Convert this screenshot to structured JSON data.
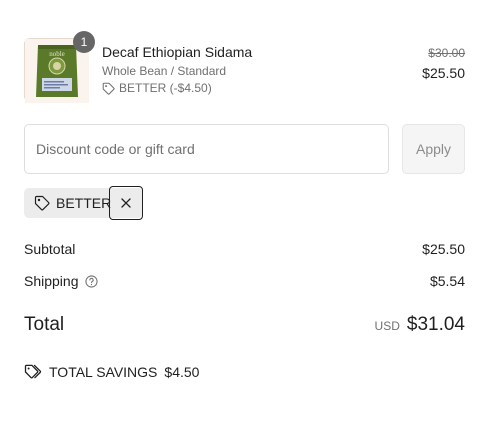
{
  "colors": {
    "text": "#1f1f1f",
    "muted": "#707070",
    "chip_bg": "#ececec",
    "badge_bg": "#666666"
  },
  "product": {
    "name": "Decaf Ethiopian Sidama",
    "variant": "Whole Bean / Standard",
    "discount_label": "BETTER (-$4.50)",
    "original_price": "$30.00",
    "price": "$25.50",
    "quantity": "1",
    "brand_text": "noble"
  },
  "discount_form": {
    "placeholder": "Discount code or gift card",
    "apply_label": "Apply"
  },
  "applied_code": {
    "label": "BETTER"
  },
  "summary": {
    "subtotal_label": "Subtotal",
    "subtotal_value": "$25.50",
    "shipping_label": "Shipping",
    "shipping_value": "$5.54",
    "total_label": "Total",
    "currency": "USD",
    "total_value": "$31.04",
    "savings_label": "TOTAL SAVINGS",
    "savings_value": "$4.50"
  },
  "icons": [
    "tag-icon",
    "close-icon",
    "help-circle-icon",
    "tags-icon"
  ]
}
